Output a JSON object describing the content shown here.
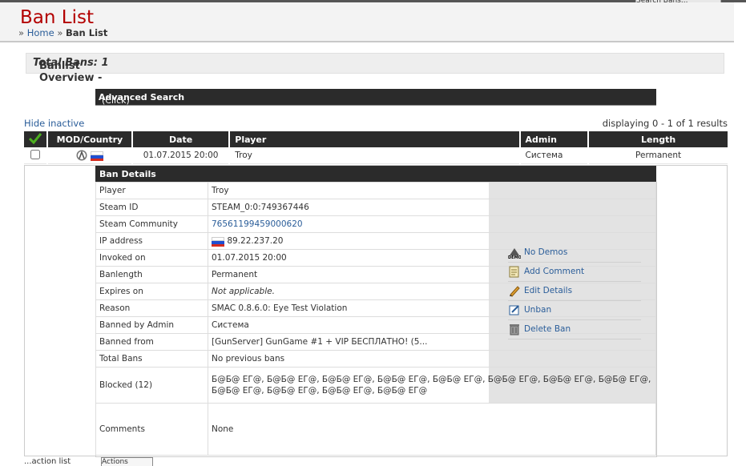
{
  "top_search_tab": "Search Bans...",
  "page_title": "Ban List",
  "breadcrumb": {
    "sep": "»",
    "home": "Home",
    "current": "Ban List"
  },
  "overview": {
    "title": "Banlist Overview - ",
    "total": "Total Bans: 1"
  },
  "advanced_search": {
    "label": "Advanced Search",
    "hint": "(Click)"
  },
  "hide_inactive": "Hide inactive",
  "displaying": "displaying 0 - 1 of 1 results",
  "columns": [
    "MOD/Country",
    "Date",
    "Player",
    "Admin",
    "Length"
  ],
  "rows": [
    {
      "date": "01.07.2015 20:00",
      "player": "Troy",
      "admin": "Система",
      "length": "Permanent"
    }
  ],
  "ban_details": {
    "title": "Ban Details",
    "fields": [
      {
        "label": "Player",
        "value": "Troy"
      },
      {
        "label": "Steam ID",
        "value": "STEAM_0:0:749367446"
      },
      {
        "label": "Steam Community",
        "value": "76561199459000620"
      },
      {
        "label": "IP address",
        "value": "89.22.237.20"
      },
      {
        "label": "Invoked on",
        "value": "01.07.2015 20:00"
      },
      {
        "label": "Banlength",
        "value": "Permanent"
      },
      {
        "label": "Expires on",
        "value": "Not applicable."
      },
      {
        "label": "Reason",
        "value": "SMAC 0.8.6.0: Eye Test Violation"
      },
      {
        "label": "Banned by Admin",
        "value": "Система"
      },
      {
        "label": "Banned from",
        "value": "[GunServer] GunGame #1 + VIP БЕСПЛАТНО! (5..."
      },
      {
        "label": "Total Bans",
        "value": "No previous bans"
      },
      {
        "label": "Blocked (12)",
        "value": "Б@Б@ ЕГ@, Б@Б@ ЕГ@, Б@Б@ ЕГ@, Б@Б@ ЕГ@, Б@Б@ ЕГ@, Б@Б@ ЕГ@, Б@Б@ ЕГ@, Б@Б@ ЕГ@, Б@Б@ ЕГ@, Б@Б@ ЕГ@, Б@Б@ ЕГ@, Б@Б@ ЕГ@"
      },
      {
        "label": "Comments",
        "value": "None"
      }
    ],
    "actions": [
      "No Demos",
      "Add Comment",
      "Edit Details",
      "Unban",
      "Delete Ban"
    ]
  },
  "bottom": {
    "label": "...action list",
    "select_value": "Actions"
  },
  "colors": {
    "title_red": "#b30000",
    "link_blue": "#2a5d99",
    "bar_dark": "#2b2b2b",
    "panel_grey": "#e3e3e3"
  },
  "flags": {
    "country": "russia-flag"
  }
}
